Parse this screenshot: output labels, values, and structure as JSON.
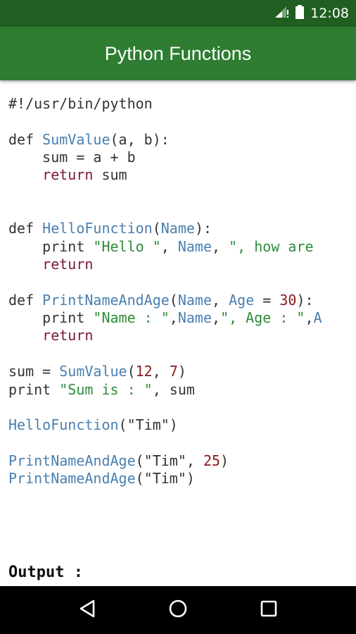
{
  "status_bar": {
    "time": "12:08"
  },
  "app_bar": {
    "title": "Python Functions"
  },
  "code_lines": [
    [
      {
        "t": "#!/usr/bin/python"
      }
    ],
    [],
    [
      {
        "t": "def ",
        "c": "kw0"
      },
      {
        "t": "SumValue",
        "c": "fn"
      },
      {
        "t": "(a, b):"
      }
    ],
    [
      {
        "t": "    sum = a + b"
      }
    ],
    [
      {
        "t": "    "
      },
      {
        "t": "return",
        "c": "kw"
      },
      {
        "t": " sum"
      }
    ],
    [],
    [],
    [
      {
        "t": "def "
      },
      {
        "t": "HelloFunction",
        "c": "fn"
      },
      {
        "t": "("
      },
      {
        "t": "Name",
        "c": "fn"
      },
      {
        "t": "):"
      }
    ],
    [
      {
        "t": "    print "
      },
      {
        "t": "\"Hello \"",
        "c": "str"
      },
      {
        "t": ", "
      },
      {
        "t": "Name",
        "c": "fn"
      },
      {
        "t": ", "
      },
      {
        "t": "\", how are",
        "c": "str"
      }
    ],
    [
      {
        "t": "    "
      },
      {
        "t": "return",
        "c": "kw"
      }
    ],
    [],
    [
      {
        "t": "def "
      },
      {
        "t": "PrintNameAndAge",
        "c": "fn"
      },
      {
        "t": "("
      },
      {
        "t": "Name",
        "c": "fn"
      },
      {
        "t": ", "
      },
      {
        "t": "Age",
        "c": "fn"
      },
      {
        "t": " = "
      },
      {
        "t": "30",
        "c": "num"
      },
      {
        "t": "):"
      }
    ],
    [
      {
        "t": "    print "
      },
      {
        "t": "\"Name : \"",
        "c": "str"
      },
      {
        "t": ","
      },
      {
        "t": "Name",
        "c": "fn"
      },
      {
        "t": ","
      },
      {
        "t": "\", Age : \"",
        "c": "str"
      },
      {
        "t": ","
      },
      {
        "t": "A",
        "c": "fn"
      }
    ],
    [
      {
        "t": "    "
      },
      {
        "t": "return",
        "c": "kw"
      }
    ],
    [],
    [
      {
        "t": "sum = "
      },
      {
        "t": "SumValue",
        "c": "fn"
      },
      {
        "t": "("
      },
      {
        "t": "12",
        "c": "num"
      },
      {
        "t": ", "
      },
      {
        "t": "7",
        "c": "num"
      },
      {
        "t": ")"
      }
    ],
    [
      {
        "t": "print "
      },
      {
        "t": "\"Sum is : \"",
        "c": "str"
      },
      {
        "t": ", sum"
      }
    ],
    [],
    [
      {
        "t": "HelloFunction",
        "c": "fn"
      },
      {
        "t": "(\"Tim\")"
      }
    ],
    [],
    [
      {
        "t": "PrintNameAndAge",
        "c": "fn"
      },
      {
        "t": "(\"Tim\", "
      },
      {
        "t": "25",
        "c": "num"
      },
      {
        "t": ")"
      }
    ],
    [
      {
        "t": "PrintNameAndAge",
        "c": "fn"
      },
      {
        "t": "(\"Tim\")"
      }
    ]
  ],
  "output": {
    "label": "Output :"
  },
  "navigation": {
    "back_icon": "back-icon",
    "home_icon": "home-icon",
    "recents_icon": "recents-icon"
  },
  "colors": {
    "status_bar": "#215e21",
    "app_bar": "#2e7d32",
    "keyword": "#7a1a3a",
    "function": "#4a7fb0",
    "string": "#2e8b3a",
    "number": "#8b1a1a"
  }
}
